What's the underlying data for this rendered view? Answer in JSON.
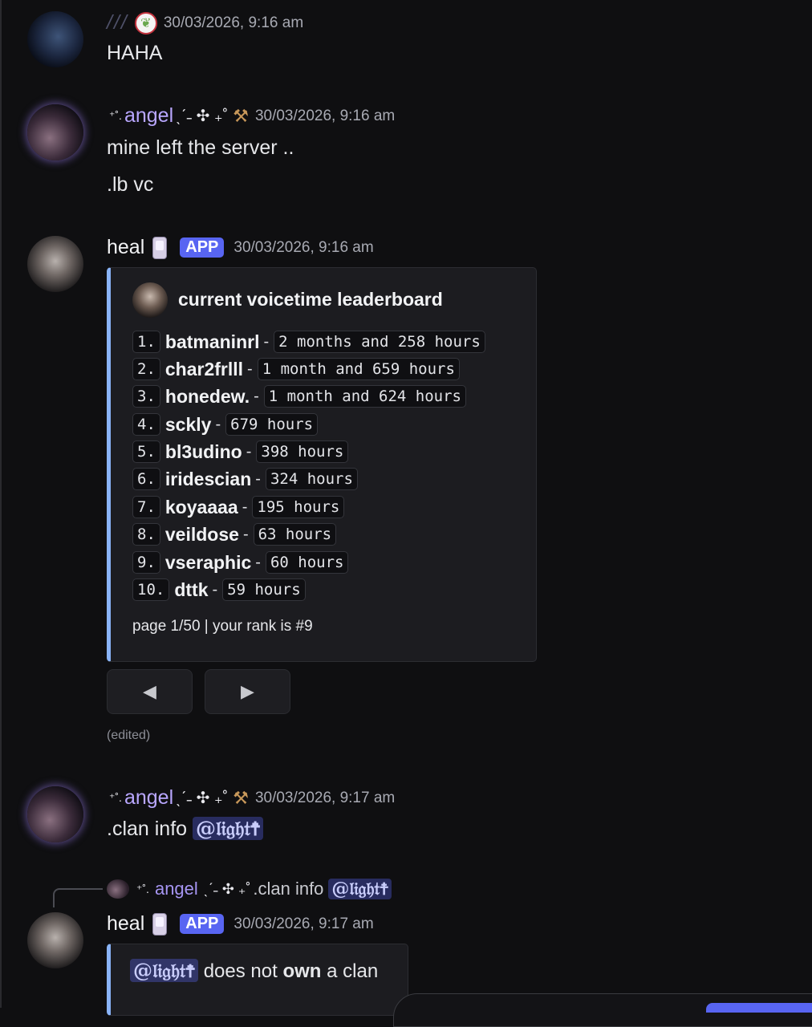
{
  "messages": [
    {
      "username": "///",
      "timestamp": "30/03/2026, 9:16 am",
      "lines": [
        "HAHA"
      ]
    },
    {
      "username": "angel",
      "name_prefix": "⁺˚.",
      "name_suffix": "ˎˊ˗ ✣ ₊˚",
      "timestamp": "30/03/2026, 9:16 am",
      "lines": [
        "mine left the server ..",
        ".lb vc"
      ]
    },
    {
      "username": "heal",
      "badge": "APP",
      "timestamp": "30/03/2026, 9:16 am",
      "embed": {
        "title": "current voicetime leaderboard",
        "entries": [
          {
            "rank": "1.",
            "name": "batmaninrl",
            "value": "2 months and 258 hours"
          },
          {
            "rank": "2.",
            "name": "char2frlll",
            "value": "1 month and 659 hours"
          },
          {
            "rank": "3.",
            "name": "honedew.",
            "value": "1 month and 624 hours"
          },
          {
            "rank": "4.",
            "name": "sckly",
            "value": "679 hours"
          },
          {
            "rank": "5.",
            "name": "bl3udino",
            "value": "398 hours"
          },
          {
            "rank": "6.",
            "name": "iridescian",
            "value": "324 hours"
          },
          {
            "rank": "7.",
            "name": "koyaaaa",
            "value": "195 hours"
          },
          {
            "rank": "8.",
            "name": "veildose",
            "value": "63 hours"
          },
          {
            "rank": "9.",
            "name": "vseraphic",
            "value": "60 hours"
          },
          {
            "rank": "10.",
            "name": "dttk",
            "value": "59 hours"
          }
        ],
        "separator": "-",
        "footer": "page 1/50 | your rank is #9"
      },
      "buttons": {
        "prev": "◀",
        "next": "▶"
      },
      "edited": "(edited)"
    },
    {
      "username": "angel",
      "timestamp": "30/03/2026, 9:17 am",
      "text": ".clan info",
      "mention": "@𝔩𝔦𝔤𝔥𝔱☨"
    },
    {
      "username": "heal",
      "badge": "APP",
      "timestamp": "30/03/2026, 9:17 am",
      "reply": {
        "username": "angel",
        "text": ".clan info",
        "mention": "@𝔩𝔦𝔤𝔥𝔱☨"
      },
      "embed": {
        "mention": "@𝔩𝔦𝔤𝔥𝔱☨",
        "text_before": "does not",
        "text_bold": "own",
        "text_after": "a clan"
      }
    }
  ],
  "colors": {
    "background": "#0f0f11",
    "accent": "#5865f2",
    "embed_bar": "#8ab4f8",
    "angel_name": "#b9a7ff"
  }
}
